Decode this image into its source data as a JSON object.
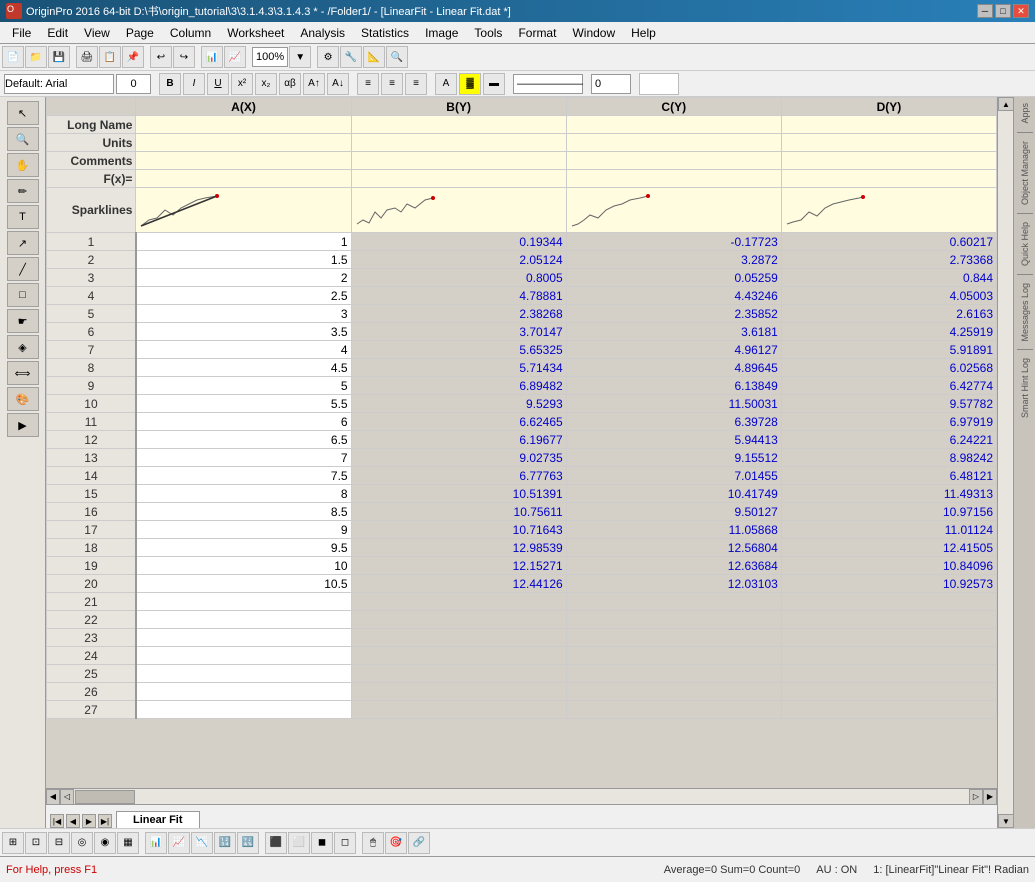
{
  "titlebar": {
    "title": "OriginPro 2016 64-bit  D:\\书\\origin_tutorial\\3\\3.1.4.3\\3.1.4.3 * - /Folder1/ - [LinearFit - Linear Fit.dat *]",
    "icon": "origin-icon",
    "minimize": "─",
    "maximize": "□",
    "close": "✕"
  },
  "menubar": {
    "items": [
      "File",
      "Edit",
      "View",
      "Page",
      "Column",
      "Worksheet",
      "Analysis",
      "Statistics",
      "Image",
      "Tools",
      "Format",
      "Window",
      "Help"
    ]
  },
  "toolbar2": {
    "font": "Default: Arial",
    "size": "0"
  },
  "columns": {
    "headers": [
      "A(X)",
      "B(Y)",
      "C(Y)",
      "D(Y)"
    ]
  },
  "row_labels": [
    "Long Name",
    "Units",
    "Comments",
    "F(x)=",
    "Sparklines"
  ],
  "data": [
    {
      "row": 1,
      "a": "1",
      "b": "0.19344",
      "c": "-0.17723",
      "d": "0.60217"
    },
    {
      "row": 2,
      "a": "1.5",
      "b": "2.05124",
      "c": "3.2872",
      "d": "2.73368"
    },
    {
      "row": 3,
      "a": "2",
      "b": "0.8005",
      "c": "0.05259",
      "d": "0.844"
    },
    {
      "row": 4,
      "a": "2.5",
      "b": "4.78881",
      "c": "4.43246",
      "d": "4.05003"
    },
    {
      "row": 5,
      "a": "3",
      "b": "2.38268",
      "c": "2.35852",
      "d": "2.6163"
    },
    {
      "row": 6,
      "a": "3.5",
      "b": "3.70147",
      "c": "3.6181",
      "d": "4.25919"
    },
    {
      "row": 7,
      "a": "4",
      "b": "5.65325",
      "c": "4.96127",
      "d": "5.91891"
    },
    {
      "row": 8,
      "a": "4.5",
      "b": "5.71434",
      "c": "4.89645",
      "d": "6.02568"
    },
    {
      "row": 9,
      "a": "5",
      "b": "6.89482",
      "c": "6.13849",
      "d": "6.42774"
    },
    {
      "row": 10,
      "a": "5.5",
      "b": "9.5293",
      "c": "11.50031",
      "d": "9.57782"
    },
    {
      "row": 11,
      "a": "6",
      "b": "6.62465",
      "c": "6.39728",
      "d": "6.97919"
    },
    {
      "row": 12,
      "a": "6.5",
      "b": "6.19677",
      "c": "5.94413",
      "d": "6.24221"
    },
    {
      "row": 13,
      "a": "7",
      "b": "9.02735",
      "c": "9.15512",
      "d": "8.98242"
    },
    {
      "row": 14,
      "a": "7.5",
      "b": "6.77763",
      "c": "7.01455",
      "d": "6.48121"
    },
    {
      "row": 15,
      "a": "8",
      "b": "10.51391",
      "c": "10.41749",
      "d": "11.49313"
    },
    {
      "row": 16,
      "a": "8.5",
      "b": "10.75611",
      "c": "9.50127",
      "d": "10.97156"
    },
    {
      "row": 17,
      "a": "9",
      "b": "10.71643",
      "c": "11.05868",
      "d": "11.01124"
    },
    {
      "row": 18,
      "a": "9.5",
      "b": "12.98539",
      "c": "12.56804",
      "d": "12.41505"
    },
    {
      "row": 19,
      "a": "10",
      "b": "12.15271",
      "c": "12.63684",
      "d": "10.84096"
    },
    {
      "row": 20,
      "a": "10.5",
      "b": "12.44126",
      "c": "12.03103",
      "d": "10.92573"
    },
    {
      "row": 21,
      "a": "",
      "b": "",
      "c": "",
      "d": ""
    },
    {
      "row": 22,
      "a": "",
      "b": "",
      "c": "",
      "d": ""
    },
    {
      "row": 23,
      "a": "",
      "b": "",
      "c": "",
      "d": ""
    },
    {
      "row": 24,
      "a": "",
      "b": "",
      "c": "",
      "d": ""
    },
    {
      "row": 25,
      "a": "",
      "b": "",
      "c": "",
      "d": ""
    },
    {
      "row": 26,
      "a": "",
      "b": "",
      "c": "",
      "d": ""
    },
    {
      "row": 27,
      "a": "",
      "b": "",
      "c": "",
      "d": ""
    }
  ],
  "tabs": {
    "sheets": [
      "Linear Fit"
    ],
    "active": "Linear Fit"
  },
  "statusbar": {
    "help": "For Help, press F1",
    "stats": "Average=0  Sum=0  Count=0",
    "au": "AU : ON",
    "location": "1: [LinearFit]\"Linear Fit\"! Radian"
  },
  "right_panels": {
    "apps": "Apps",
    "object_manager": "Object Manager",
    "quick_help": "Quick Help",
    "messages_log": "Messages Log",
    "smart_hint_log": "Smart Hint Log"
  }
}
